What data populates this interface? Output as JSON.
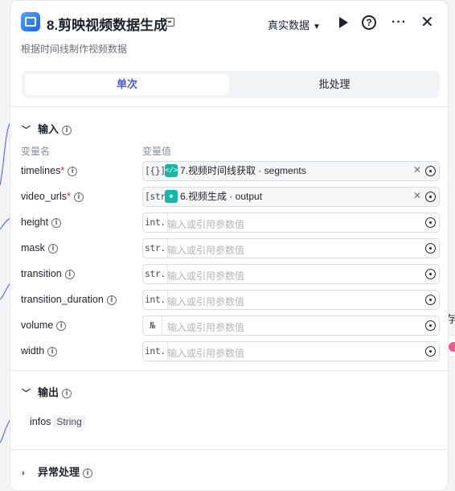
{
  "node": {
    "title": "8.剪映视频数据生成",
    "subtitle": "根据时间线制作视频数据",
    "data_mode": "真实数据",
    "actions": [
      "play-icon",
      "help-icon",
      "more-icon",
      "close-icon"
    ]
  },
  "tabs": [
    {
      "label": "单次",
      "active": true
    },
    {
      "label": "批处理",
      "active": false
    }
  ],
  "input_section": {
    "title": "输入",
    "col_name": "变量名",
    "col_value": "变量值",
    "rows": [
      {
        "name": "timelines",
        "required": "*",
        "type": "[{}]",
        "ref": "7.视频时间线获取 · segments",
        "ref_icon": "</>",
        "placeholder": ""
      },
      {
        "name": "video_urls",
        "required": "*",
        "type": "[str]",
        "ref": "6.视频生成 · output",
        "ref_icon": "◈",
        "placeholder": ""
      },
      {
        "name": "height",
        "required": "",
        "type": "int.",
        "ref": "",
        "placeholder": "输入或引用参数值"
      },
      {
        "name": "mask",
        "required": "",
        "type": "str.",
        "ref": "",
        "placeholder": "输入或引用参数值"
      },
      {
        "name": "transition",
        "required": "",
        "type": "str.",
        "ref": "",
        "placeholder": "输入或引用参数值"
      },
      {
        "name": "transition_duration",
        "required": "",
        "type": "int.",
        "ref": "",
        "placeholder": "输入或引用参数值"
      },
      {
        "name": "volume",
        "required": "",
        "type": "№",
        "ref": "",
        "placeholder": "输入或引用参数值"
      },
      {
        "name": "width",
        "required": "",
        "type": "int.",
        "ref": "",
        "placeholder": "输入或引用参数值"
      }
    ]
  },
  "output_section": {
    "title": "输出",
    "var_name": "infos",
    "var_type": "String"
  },
  "error_section": {
    "title": "异常处理"
  },
  "edge": {
    "label": "存"
  },
  "colors": {
    "accent": "#4d53e8",
    "ref_badge": "#14b8a6",
    "required": "#f5222d"
  }
}
